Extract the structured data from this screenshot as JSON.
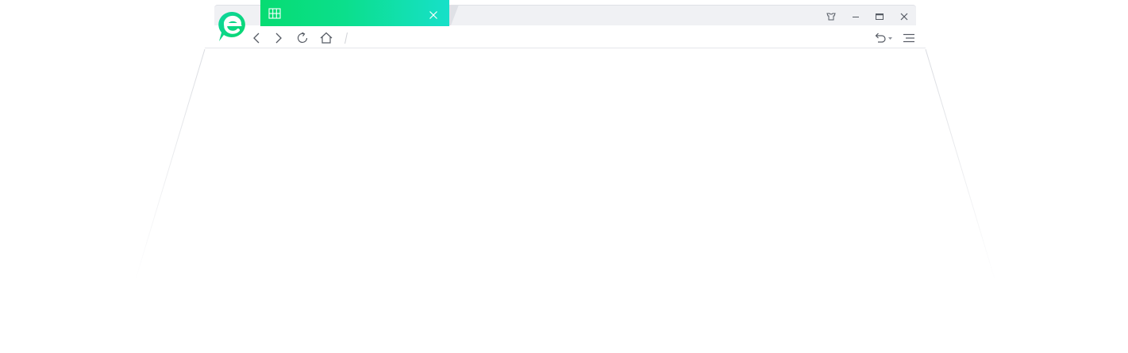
{
  "tab": {
    "title": "",
    "gradient_start": "#06dc72",
    "gradient_end": "#17e0c9",
    "icon": "grid-icon",
    "close_icon": "close-icon"
  },
  "logo": {
    "icon": "browser-logo-icon",
    "color": "#0fd98a"
  },
  "navigation": {
    "back_icon": "chevron-left-icon",
    "forward_icon": "chevron-right-icon",
    "reload_icon": "reload-icon",
    "home_icon": "home-icon"
  },
  "address_bar": {
    "value": "",
    "placeholder": ""
  },
  "toolbar_right": {
    "undo_icon": "undo-icon",
    "undo_dropdown_icon": "caret-down-icon",
    "menu_icon": "hamburger-menu-icon"
  },
  "window_controls": {
    "skin_icon": "shirt-icon",
    "minimize_icon": "minimize-icon",
    "maximize_icon": "maximize-icon",
    "close_icon": "close-icon"
  },
  "colors": {
    "titlebar_bg": "#f0f1f4",
    "toolbar_bg": "#ffffff",
    "icon_color": "#555a63"
  }
}
